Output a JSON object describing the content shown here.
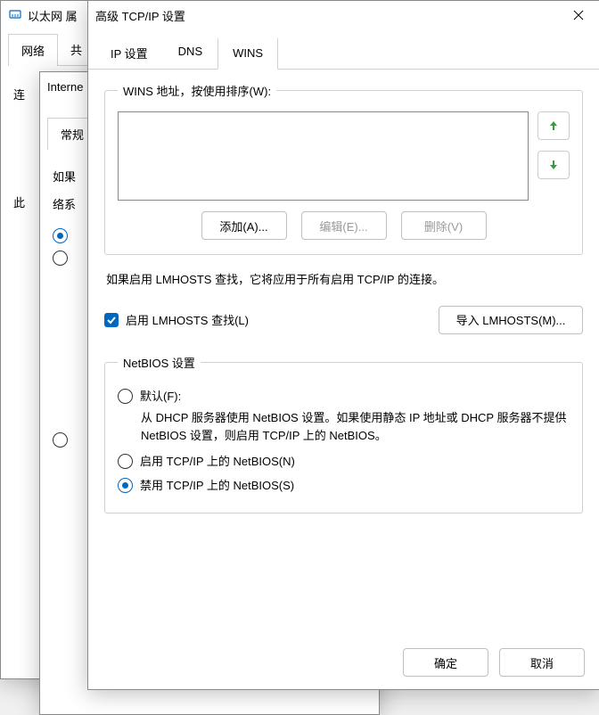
{
  "bg": {
    "win1_title": "以太网 属",
    "tab_net": "网络",
    "tab_share_partial": "共",
    "label_connect_partial": "连",
    "label_internet_partial": "Interne",
    "tab_general_partial": "常规",
    "text_ifuse_partial": "如果",
    "text_nets_partial": "络系",
    "text_this_partial": "此"
  },
  "dlg": {
    "title": "高级 TCP/IP 设置",
    "tabs": {
      "ip": "IP 设置",
      "dns": "DNS",
      "wins": "WINS"
    },
    "wins_group": "WINS 地址，按使用排序(W):",
    "btn_add": "添加(A)...",
    "btn_edit": "编辑(E)...",
    "btn_del": "删除(V)",
    "lmhosts_note": "如果启用 LMHOSTS 查找，它将应用于所有启用 TCP/IP 的连接。",
    "chk_lmhosts": "启用 LMHOSTS 查找(L)",
    "btn_import": "导入 LMHOSTS(M)...",
    "netbios_group": "NetBIOS 设置",
    "rb_default": "默认(F):",
    "rb_default_desc": "从 DHCP 服务器使用 NetBIOS 设置。如果使用静态 IP 地址或 DHCP 服务器不提供 NetBIOS 设置，则启用 TCP/IP 上的 NetBIOS。",
    "rb_enable": "启用 TCP/IP 上的 NetBIOS(N)",
    "rb_disable": "禁用 TCP/IP 上的 NetBIOS(S)",
    "ok": "确定",
    "cancel": "取消"
  }
}
